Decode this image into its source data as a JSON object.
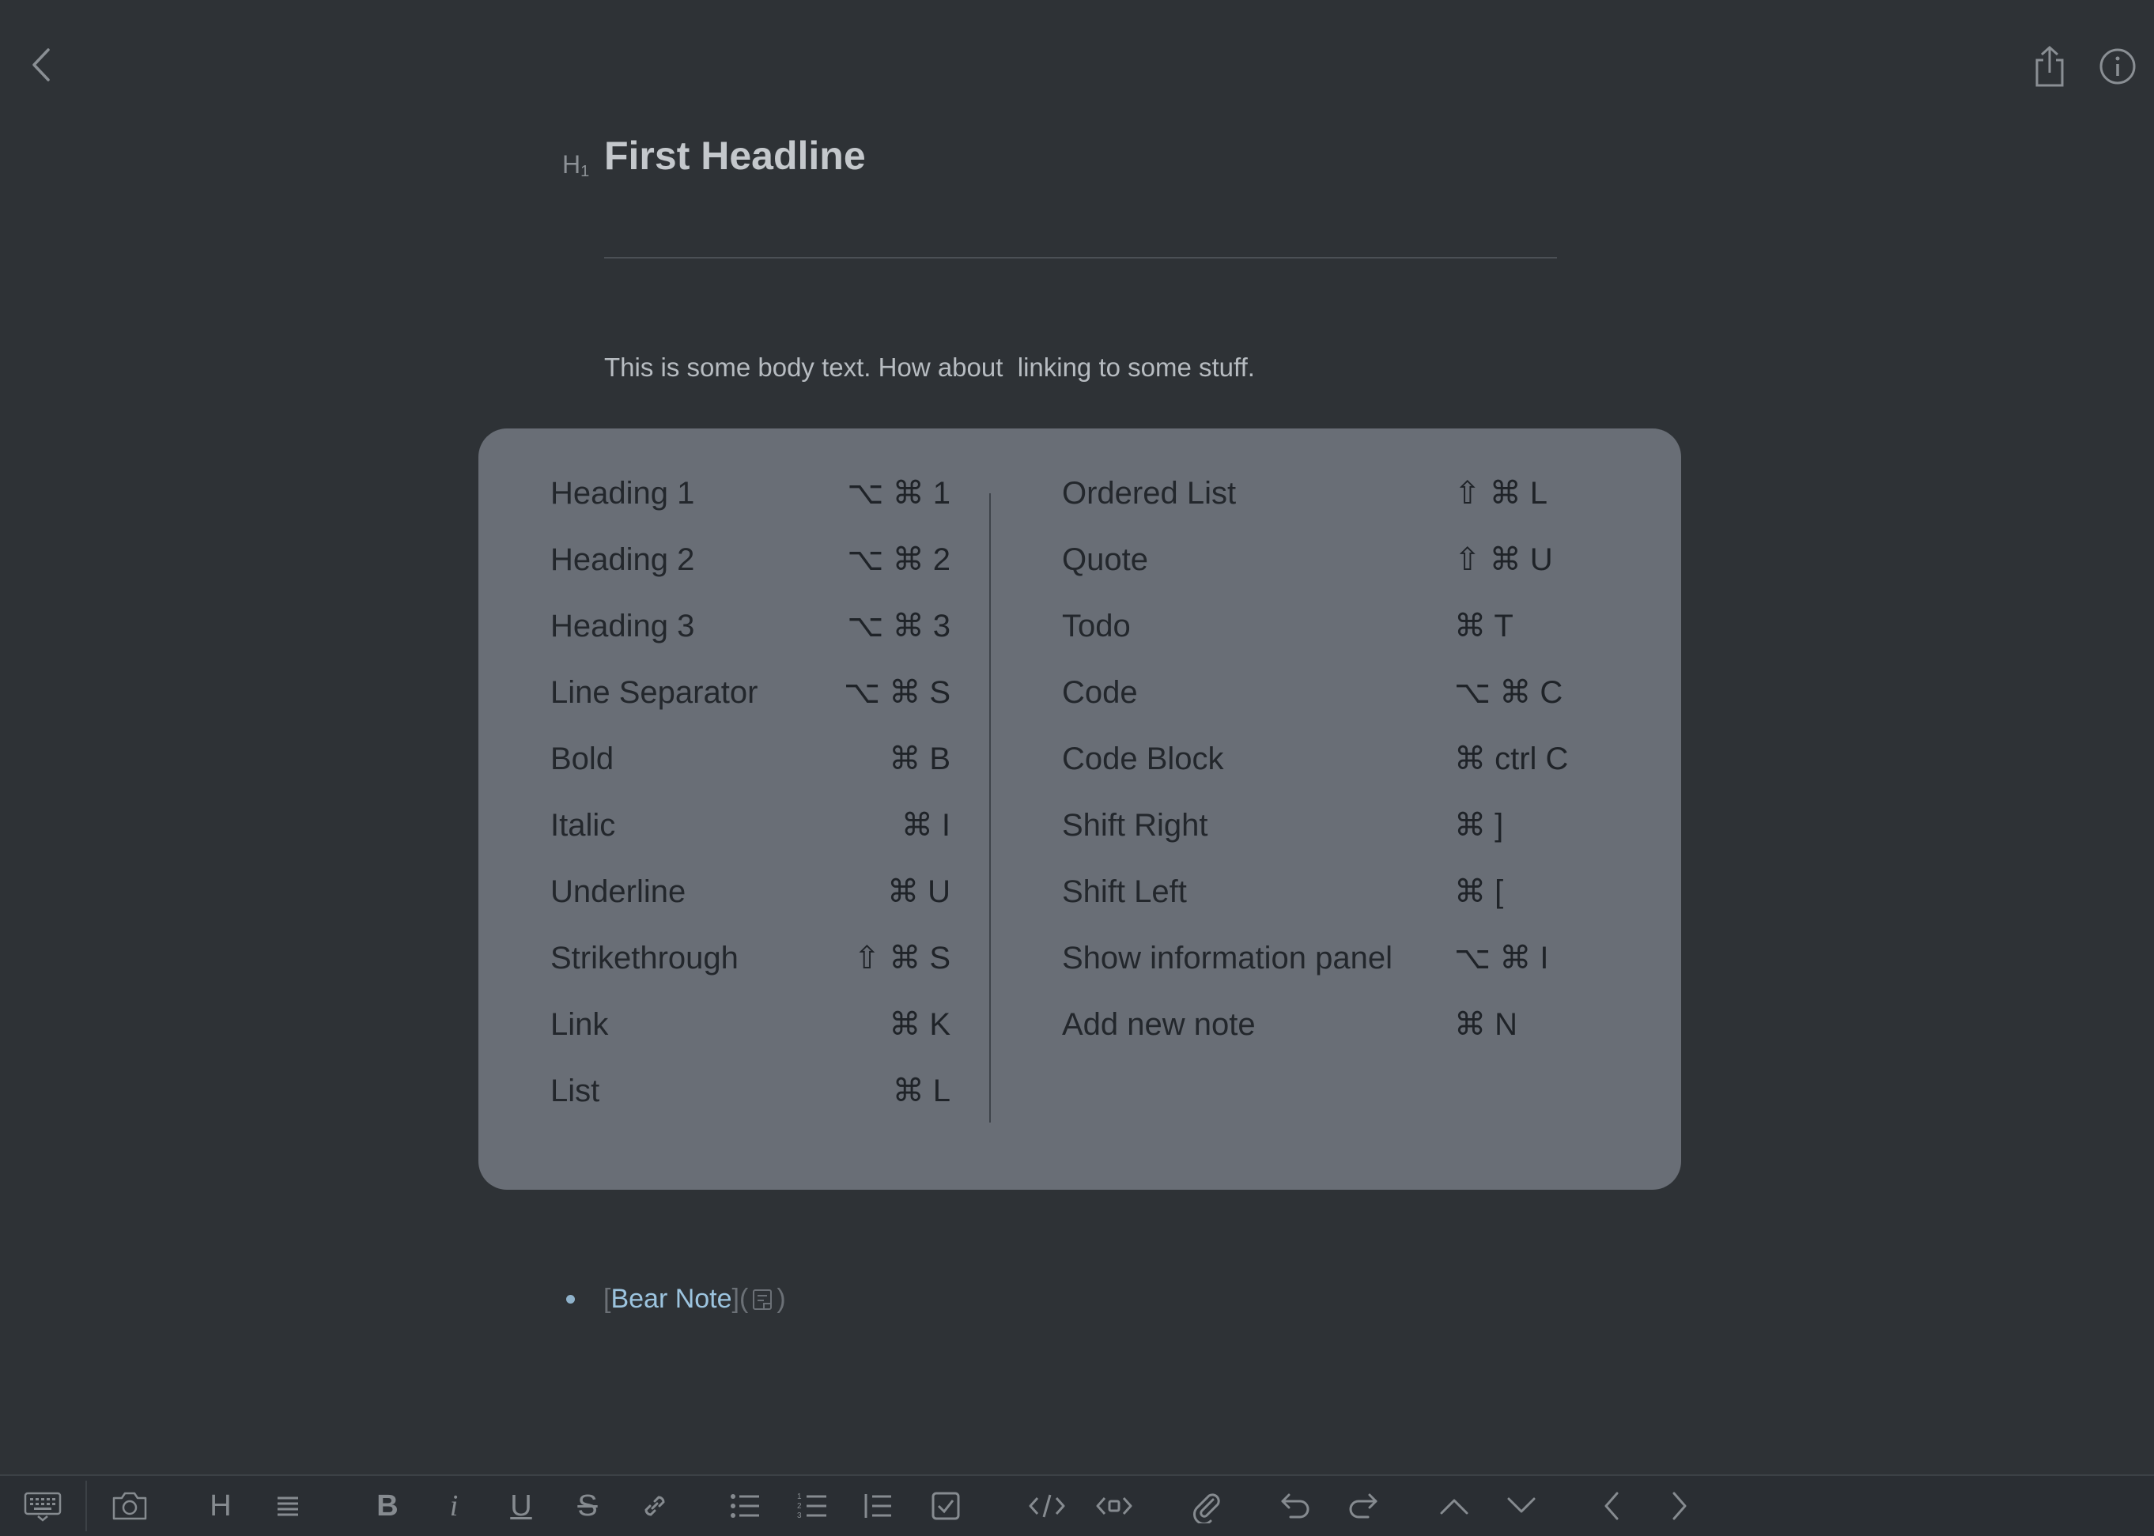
{
  "header": {
    "back_icon": "chevron-left-icon",
    "share_icon": "share-icon",
    "info_icon": "info-icon"
  },
  "note": {
    "heading_marker": "H",
    "heading_marker_sub": "1",
    "title": "First Headline",
    "body": "This is some body text. How about  linking to some stuff.",
    "bullet": {
      "open_bracket": "[",
      "link_text": "Bear Note",
      "mid": "](",
      "close": ")",
      "icon": "note-icon"
    }
  },
  "shortcuts": {
    "left": [
      {
        "label": "Heading 1",
        "keys": "⌥ ⌘ 1"
      },
      {
        "label": "Heading 2",
        "keys": "⌥ ⌘ 2"
      },
      {
        "label": "Heading 3",
        "keys": "⌥ ⌘ 3"
      },
      {
        "label": "Line Separator",
        "keys": "⌥ ⌘ S"
      },
      {
        "label": "Bold",
        "keys": "⌘ B"
      },
      {
        "label": "Italic",
        "keys": "⌘ I"
      },
      {
        "label": "Underline",
        "keys": "⌘ U"
      },
      {
        "label": "Strikethrough",
        "keys": "⇧ ⌘ S"
      },
      {
        "label": "Link",
        "keys": "⌘ K"
      },
      {
        "label": "List",
        "keys": "⌘ L"
      }
    ],
    "right": [
      {
        "label": "Ordered List",
        "keys": "⇧ ⌘ L"
      },
      {
        "label": "Quote",
        "keys": "⇧ ⌘ U"
      },
      {
        "label": "Todo",
        "keys": "⌘ T"
      },
      {
        "label": "Code",
        "keys": "⌥ ⌘ C"
      },
      {
        "label": "Code Block",
        "keys": "⌘ ctrl C"
      },
      {
        "label": "Shift Right",
        "keys": "⌘ ]"
      },
      {
        "label": "Shift Left",
        "keys": "⌘ ["
      },
      {
        "label": "Show information panel",
        "keys": "⌥ ⌘ I"
      },
      {
        "label": "Add new note",
        "keys": "⌘ N"
      }
    ]
  },
  "toolbar": {
    "heading_label": "H",
    "bold_label": "B",
    "italic_label": "i",
    "underline_label": "U",
    "strike_label": "S",
    "icons": [
      "keyboard-icon",
      "camera-icon",
      "heading-icon",
      "paragraph-icon",
      "bold-icon",
      "italic-icon",
      "underline-icon",
      "strikethrough-icon",
      "link-icon",
      "bullet-list-icon",
      "ordered-list-icon",
      "quote-icon",
      "todo-icon",
      "code-icon",
      "code-block-icon",
      "attachment-icon",
      "undo-icon",
      "redo-icon",
      "chevron-up-icon",
      "chevron-down-icon",
      "chevron-left-icon",
      "chevron-right-icon"
    ]
  }
}
